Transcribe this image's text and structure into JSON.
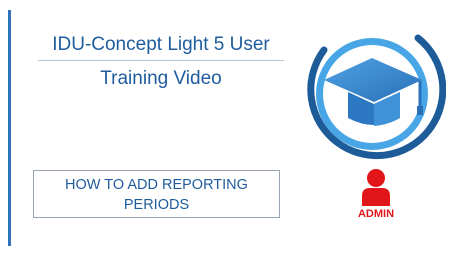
{
  "title": {
    "line1": "IDU-Concept Light 5 User",
    "line2": "Training Video"
  },
  "topic": {
    "line1": "HOW TO ADD REPORTING",
    "line2": "PERIODS"
  },
  "role": {
    "label": "ADMIN",
    "icon": "user-icon"
  },
  "logo": {
    "icon": "graduation-cap-icon"
  },
  "colors": {
    "brand_blue": "#1f5c9e",
    "accent_blue": "#2d73b9",
    "admin_red": "#e0161b"
  }
}
